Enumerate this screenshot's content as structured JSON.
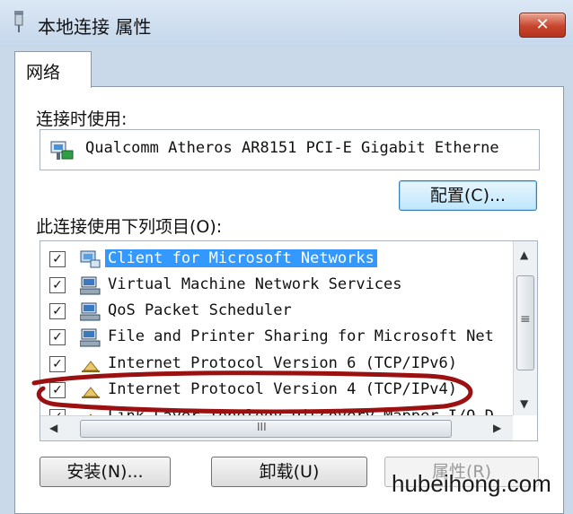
{
  "window": {
    "title": "本地连接 属性",
    "close_label": "✕"
  },
  "tabs": [
    {
      "label": "网络"
    }
  ],
  "connect_using": {
    "label": "连接时使用:",
    "adapter_name": "Qualcomm Atheros AR8151 PCI-E Gigabit Etherne"
  },
  "buttons": {
    "configure": "配置(C)...",
    "install": "安装(N)...",
    "uninstall": "卸载(U)",
    "properties": "属性(R)"
  },
  "items_label": "此连接使用下列项目(O):",
  "items": [
    {
      "label": "Client for Microsoft Networks",
      "checked": true,
      "selected": true,
      "icon": "network-client-icon"
    },
    {
      "label": "Virtual Machine Network Services",
      "checked": true,
      "selected": false,
      "icon": "network-service-icon"
    },
    {
      "label": "QoS Packet Scheduler",
      "checked": true,
      "selected": false,
      "icon": "network-service-icon"
    },
    {
      "label": "File and Printer Sharing for Microsoft Net",
      "checked": true,
      "selected": false,
      "icon": "network-service-icon"
    },
    {
      "label": "Internet Protocol Version 6 (TCP/IPv6)",
      "checked": true,
      "selected": false,
      "icon": "protocol-icon"
    },
    {
      "label": "Internet Protocol Version 4 (TCP/IPv4)",
      "checked": true,
      "selected": false,
      "icon": "protocol-icon"
    },
    {
      "label": "Link-Layer Topology Discovery Mapper I/O D",
      "checked": true,
      "selected": false,
      "icon": "protocol-icon"
    }
  ],
  "scrollbar": {
    "h_grip": "III",
    "v_grip": "≡"
  },
  "watermark": "hubeihong.com",
  "colors": {
    "selection": "#3399ff",
    "annotation": "#9b1010"
  }
}
